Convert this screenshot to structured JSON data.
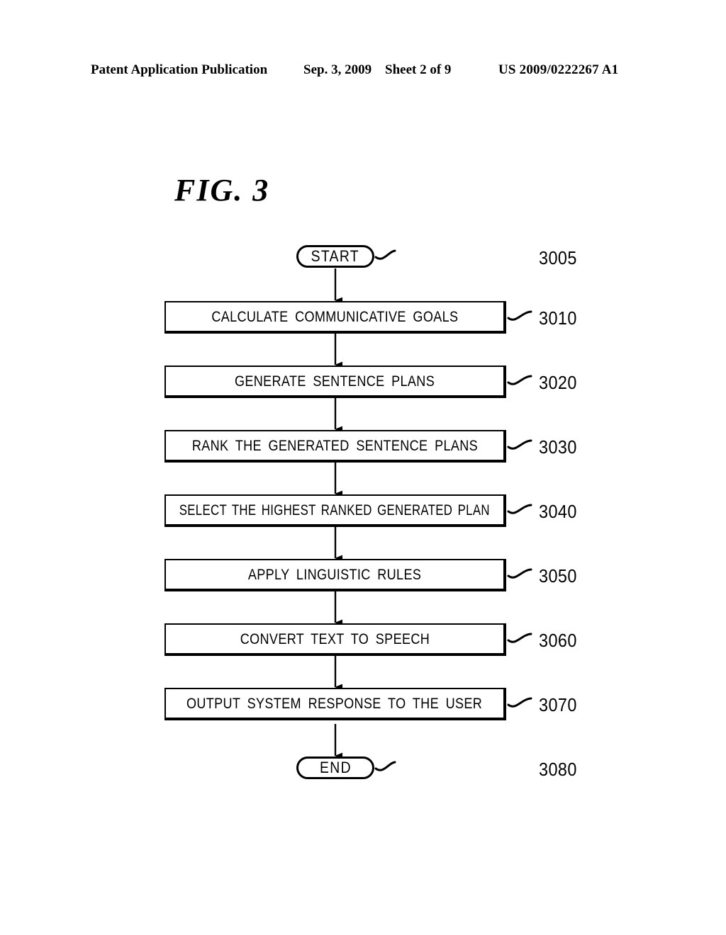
{
  "header": {
    "publication": "Patent Application Publication",
    "date": "Sep. 3, 2009",
    "sheet": "Sheet 2 of 9",
    "patent_number": "US 2009/0222267 A1"
  },
  "figure": {
    "title": "FIG. 3"
  },
  "flowchart": {
    "start": {
      "label": "START",
      "ref": "3005"
    },
    "end": {
      "label": "END",
      "ref": "3080"
    },
    "steps": [
      {
        "label": "CALCULATE COMMUNICATIVE GOALS",
        "ref": "3010"
      },
      {
        "label": "GENERATE SENTENCE PLANS",
        "ref": "3020"
      },
      {
        "label": "RANK THE GENERATED SENTENCE PLANS",
        "ref": "3030"
      },
      {
        "label": "SELECT THE HIGHEST RANKED GENERATED PLAN",
        "ref": "3040"
      },
      {
        "label": "APPLY LINGUISTIC RULES",
        "ref": "3050"
      },
      {
        "label": "CONVERT TEXT TO SPEECH",
        "ref": "3060"
      },
      {
        "label": "OUTPUT SYSTEM RESPONSE TO THE USER",
        "ref": "3070"
      }
    ]
  },
  "colors": {
    "ink": "#000000",
    "page": "#ffffff"
  }
}
